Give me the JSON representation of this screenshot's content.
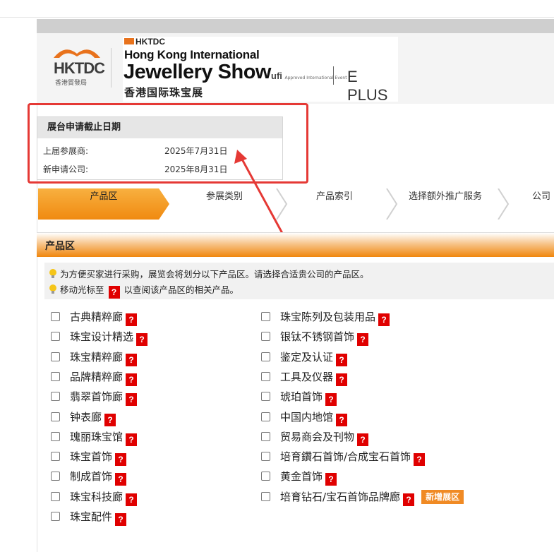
{
  "header": {
    "hktdc_logo_text": "HKTDC",
    "hktdc_logo_sub": "香港貿發局",
    "banner_brand": "HKTDC",
    "banner_line1": "Hong Kong International",
    "banner_line2": "Jewellery Show",
    "banner_line3": "香港国际珠宝展",
    "ufi_text": "ufi",
    "ufi_small": "Approved International Event",
    "eplus_text": "E PLUS"
  },
  "deadline": {
    "title": "展台申请截止日期",
    "rows": [
      {
        "label": "上届参展商:",
        "value": "2025年7月31日"
      },
      {
        "label": "新申请公司:",
        "value": "2025年8月31日"
      }
    ]
  },
  "steps": [
    "产品区",
    "参展类别",
    "产品索引",
    "选择额外推广服务",
    "公司"
  ],
  "section": {
    "title": "产品区",
    "tip1": "为方便买家进行采购，展览会将划分以下产品区。请选择合适贵公司的产品区。",
    "tip2_before": "移动光标至",
    "tip2_after": "以查阅该产品区的相关产品。",
    "qmark": "?"
  },
  "zones_left": [
    "古典精粹廊",
    "珠宝设计精选",
    "珠宝精粹廊",
    "品牌精粹廊",
    "翡翠首饰廊",
    "钟表廊",
    "瑰丽珠宝馆",
    "珠宝首饰",
    "制成首饰",
    "珠宝科技廊",
    "珠宝配件"
  ],
  "zones_right": [
    "珠宝陈列及包装用品",
    "银钛不锈钢首饰",
    "鉴定及认证",
    "工具及仪器",
    "琥珀首饰",
    "中国内地馆",
    "贸易商会及刊物",
    "培育鑽石首饰/合成宝石首饰",
    "黄金首饰",
    "培育钻石/宝石首饰品牌廊"
  ],
  "new_badge": "新增展区",
  "colors": {
    "accent_orange": "#f08a10",
    "qmark_red": "#e00000",
    "highlight_red": "#e53935"
  }
}
